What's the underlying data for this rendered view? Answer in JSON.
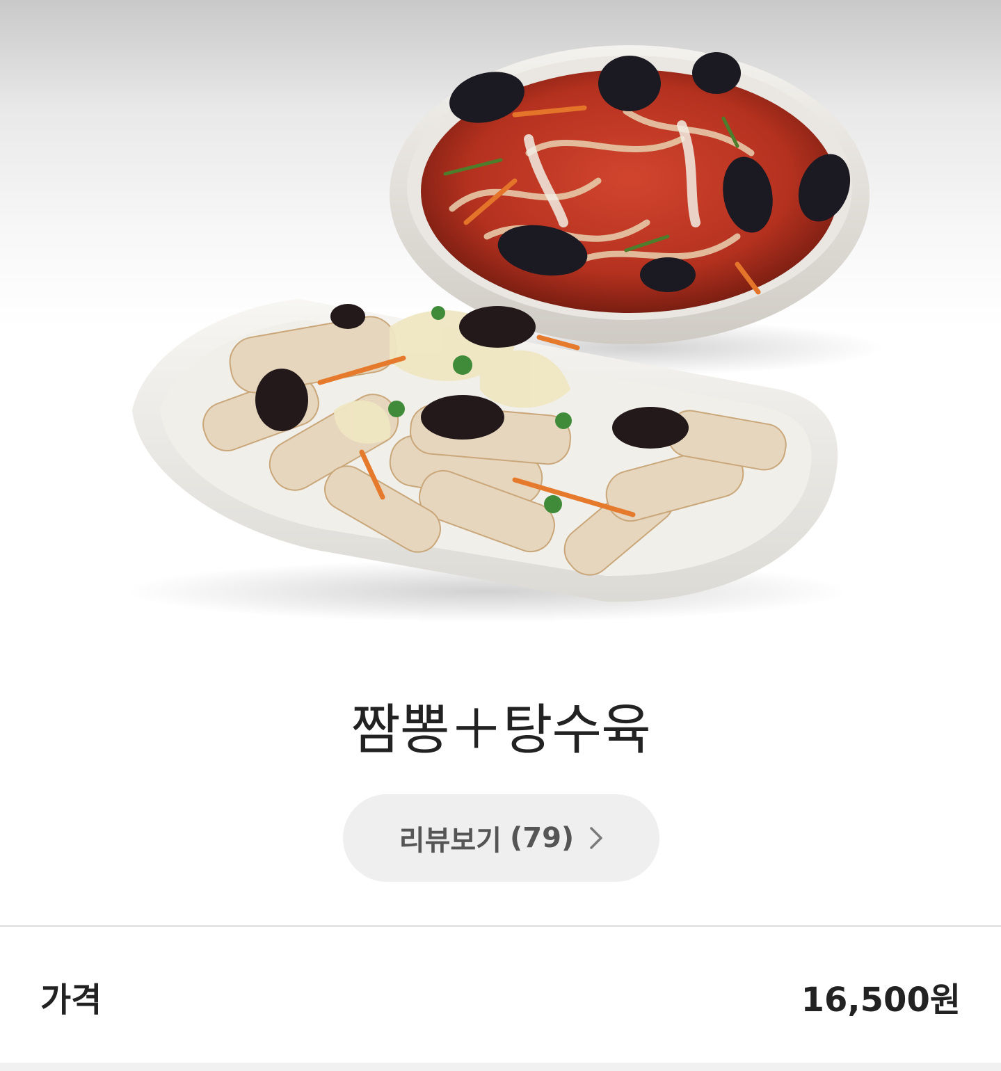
{
  "product": {
    "image_alt": "짬뽕 and 탕수육 dishes",
    "name": "짬뽕＋탕수육"
  },
  "review": {
    "label": "리뷰보기",
    "count": "(79)",
    "chevron_icon": "chevron-right-icon"
  },
  "price": {
    "label": "가격",
    "value": "16,500원"
  },
  "colors": {
    "title_text": "#222222",
    "pill_bg": "#efefef",
    "pill_text": "#555555",
    "divider": "#e4e4e4"
  }
}
